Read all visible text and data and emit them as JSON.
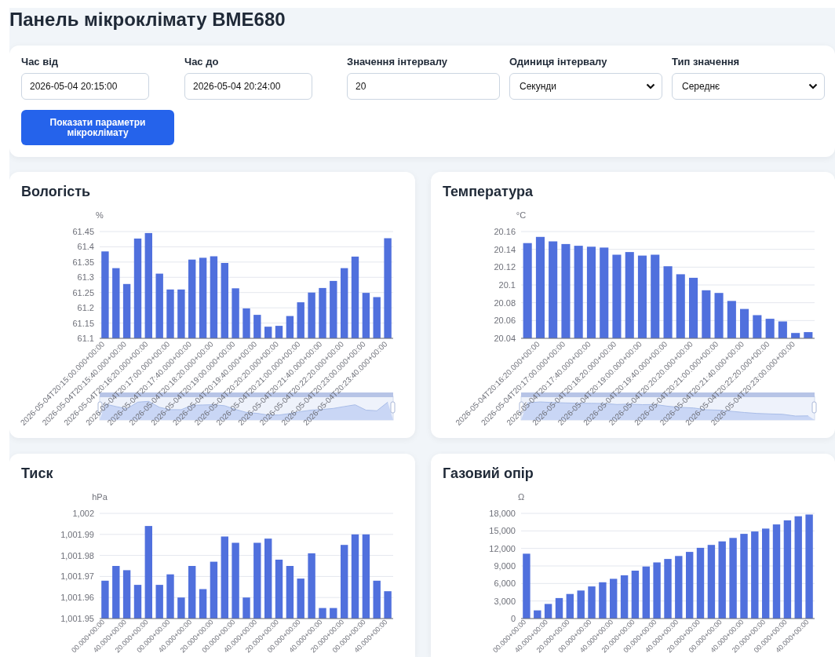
{
  "title": "Панель мікроклімату BME680",
  "filters": {
    "fields": [
      {
        "kind": "input",
        "label": "Час від",
        "value": "2026-05-04 20:15:00"
      },
      {
        "kind": "input",
        "label": "Час до",
        "value": "2026-05-04 20:24:00"
      },
      {
        "kind": "input",
        "label": "Значення інтервалу",
        "value": "20"
      },
      {
        "kind": "select",
        "label": "Одиниця інтервалу",
        "value": "Секунди"
      },
      {
        "kind": "select",
        "label": "Тип значення",
        "value": "Середнє"
      }
    ],
    "button": "Показати параметри мікроклімату"
  },
  "charts": [
    {
      "zoom_slider": true,
      "chart_data": {
        "type": "bar",
        "title": "Вологість",
        "ylabel": "%",
        "grid": true,
        "ylim": [
          61.1,
          61.45
        ],
        "yticks": [
          61.1,
          61.15,
          61.2,
          61.25,
          61.3,
          61.35,
          61.4,
          61.45
        ],
        "values": [
          61.385,
          61.33,
          61.278,
          61.427,
          61.445,
          61.312,
          61.26,
          61.26,
          61.358,
          61.364,
          61.369,
          61.347,
          61.264,
          61.198,
          61.177,
          61.138,
          61.141,
          61.173,
          61.218,
          61.25,
          61.265,
          61.288,
          61.33,
          61.368,
          61.249,
          61.235,
          61.428
        ],
        "categories": [
          "2026-05-04T20:15:00.000+00:00",
          null,
          "2026-05-04T20:15:40.000+00:00",
          null,
          "2026-05-04T20:16:20.000+00:00",
          null,
          "2026-05-04T20:17:00.000+00:00",
          null,
          "2026-05-04T20:17:40.000+00:00",
          null,
          "2026-05-04T20:18:20.000+00:00",
          null,
          "2026-05-04T20:19:00.000+00:00",
          null,
          "2026-05-04T20:19:40.000+00:00",
          null,
          "2026-05-04T20:20:20.000+00:00",
          null,
          "2026-05-04T20:21:00.000+00:00",
          null,
          "2026-05-04T20:21:40.000+00:00",
          null,
          "2026-05-04T20:22:20.000+00:00",
          null,
          "2026-05-04T20:23:00.000+00:00",
          null,
          "2026-05-04T20:23:40.000+00:00"
        ]
      }
    },
    {
      "zoom_slider": true,
      "chart_data": {
        "type": "bar",
        "title": "Температура",
        "ylabel": "°C",
        "grid": true,
        "ylim": [
          20.04,
          20.16
        ],
        "yticks": [
          20.04,
          20.06,
          20.08,
          20.1,
          20.12,
          20.14,
          20.16
        ],
        "values": [
          20.147,
          20.154,
          20.149,
          20.146,
          20.144,
          20.143,
          20.142,
          20.134,
          20.137,
          20.133,
          20.134,
          20.121,
          20.112,
          20.108,
          20.094,
          20.091,
          20.082,
          20.073,
          20.066,
          20.062,
          20.059,
          20.046,
          20.047
        ],
        "categories": [
          null,
          "2026-05-04T20:16:20.000+00:00",
          null,
          "2026-05-04T20:17:00.000+00:00",
          null,
          "2026-05-04T20:17:40.000+00:00",
          null,
          "2026-05-04T20:18:20.000+00:00",
          null,
          "2026-05-04T20:19:00.000+00:00",
          null,
          "2026-05-04T20:19:40.000+00:00",
          null,
          "2026-05-04T20:20:20.000+00:00",
          null,
          "2026-05-04T20:21:00.000+00:00",
          null,
          "2026-05-04T20:21:40.000+00:00",
          null,
          "2026-05-04T20:22:20.000+00:00",
          null,
          "2026-05-04T20:23:00.000+00:00",
          null
        ]
      }
    },
    {
      "zoom_slider": false,
      "chart_data": {
        "type": "bar",
        "title": "Тиск",
        "ylabel": "hPa",
        "grid": true,
        "ylim": [
          1001.95,
          1002
        ],
        "yticks": [
          {
            "value": 1001.95,
            "label": "1,001.95"
          },
          {
            "value": 1001.96,
            "label": "1,001.96"
          },
          {
            "value": 1001.97,
            "label": "1,001.97"
          },
          {
            "value": 1001.98,
            "label": "1,001.98"
          },
          {
            "value": 1001.99,
            "label": "1,001.99"
          },
          {
            "value": 1002,
            "label": "1,002"
          }
        ],
        "values": [
          1001.968,
          1001.975,
          1001.973,
          1001.966,
          1001.994,
          1001.966,
          1001.971,
          1001.96,
          1001.975,
          1001.964,
          1001.977,
          1001.989,
          1001.986,
          1001.96,
          1001.986,
          1001.988,
          1001.978,
          1001.975,
          1001.969,
          1001.981,
          1001.955,
          1001.955,
          1001.985,
          1001.99,
          1001.99,
          1001.968,
          1001.963
        ],
        "categories": [
          "00.000+00:00",
          null,
          "40.000+00:00",
          null,
          "20.000+00:00",
          null,
          "00.000+00:00",
          null,
          "40.000+00:00",
          null,
          "20.000+00:00",
          null,
          "00.000+00:00",
          null,
          "40.000+00:00",
          null,
          "20.000+00:00",
          null,
          "00.000+00:00",
          null,
          "40.000+00:00",
          null,
          "20.000+00:00",
          null,
          "00.000+00:00",
          null,
          "40.000+00:00"
        ]
      }
    },
    {
      "zoom_slider": false,
      "chart_data": {
        "type": "bar",
        "title": "Газовий опір",
        "ylabel": "Ω",
        "grid": true,
        "ylim": [
          0,
          18000
        ],
        "yticks": [
          {
            "value": 0,
            "label": "0"
          },
          {
            "value": 3000,
            "label": "3,000"
          },
          {
            "value": 6000,
            "label": "6,000"
          },
          {
            "value": 9000,
            "label": "9,000"
          },
          {
            "value": 12000,
            "label": "12,000"
          },
          {
            "value": 15000,
            "label": "15,000"
          },
          {
            "value": 18000,
            "label": "18,000"
          }
        ],
        "values": [
          11100,
          1400,
          2500,
          3500,
          4200,
          4800,
          5500,
          6200,
          6800,
          7400,
          8200,
          8900,
          9600,
          10200,
          10700,
          11400,
          12100,
          12600,
          13200,
          13800,
          14500,
          14900,
          15400,
          16100,
          16800,
          17500,
          17800
        ],
        "categories": [
          "00.000+00:00",
          null,
          "40.000+00:00",
          null,
          "20.000+00:00",
          null,
          "00.000+00:00",
          null,
          "40.000+00:00",
          null,
          "20.000+00:00",
          null,
          "00.000+00:00",
          null,
          "40.000+00:00",
          null,
          "20.000+00:00",
          null,
          "00.000+00:00",
          null,
          "40.000+00:00",
          null,
          "20.000+00:00",
          null,
          "00.000+00:00",
          null,
          "40.000+00:00"
        ]
      }
    }
  ]
}
